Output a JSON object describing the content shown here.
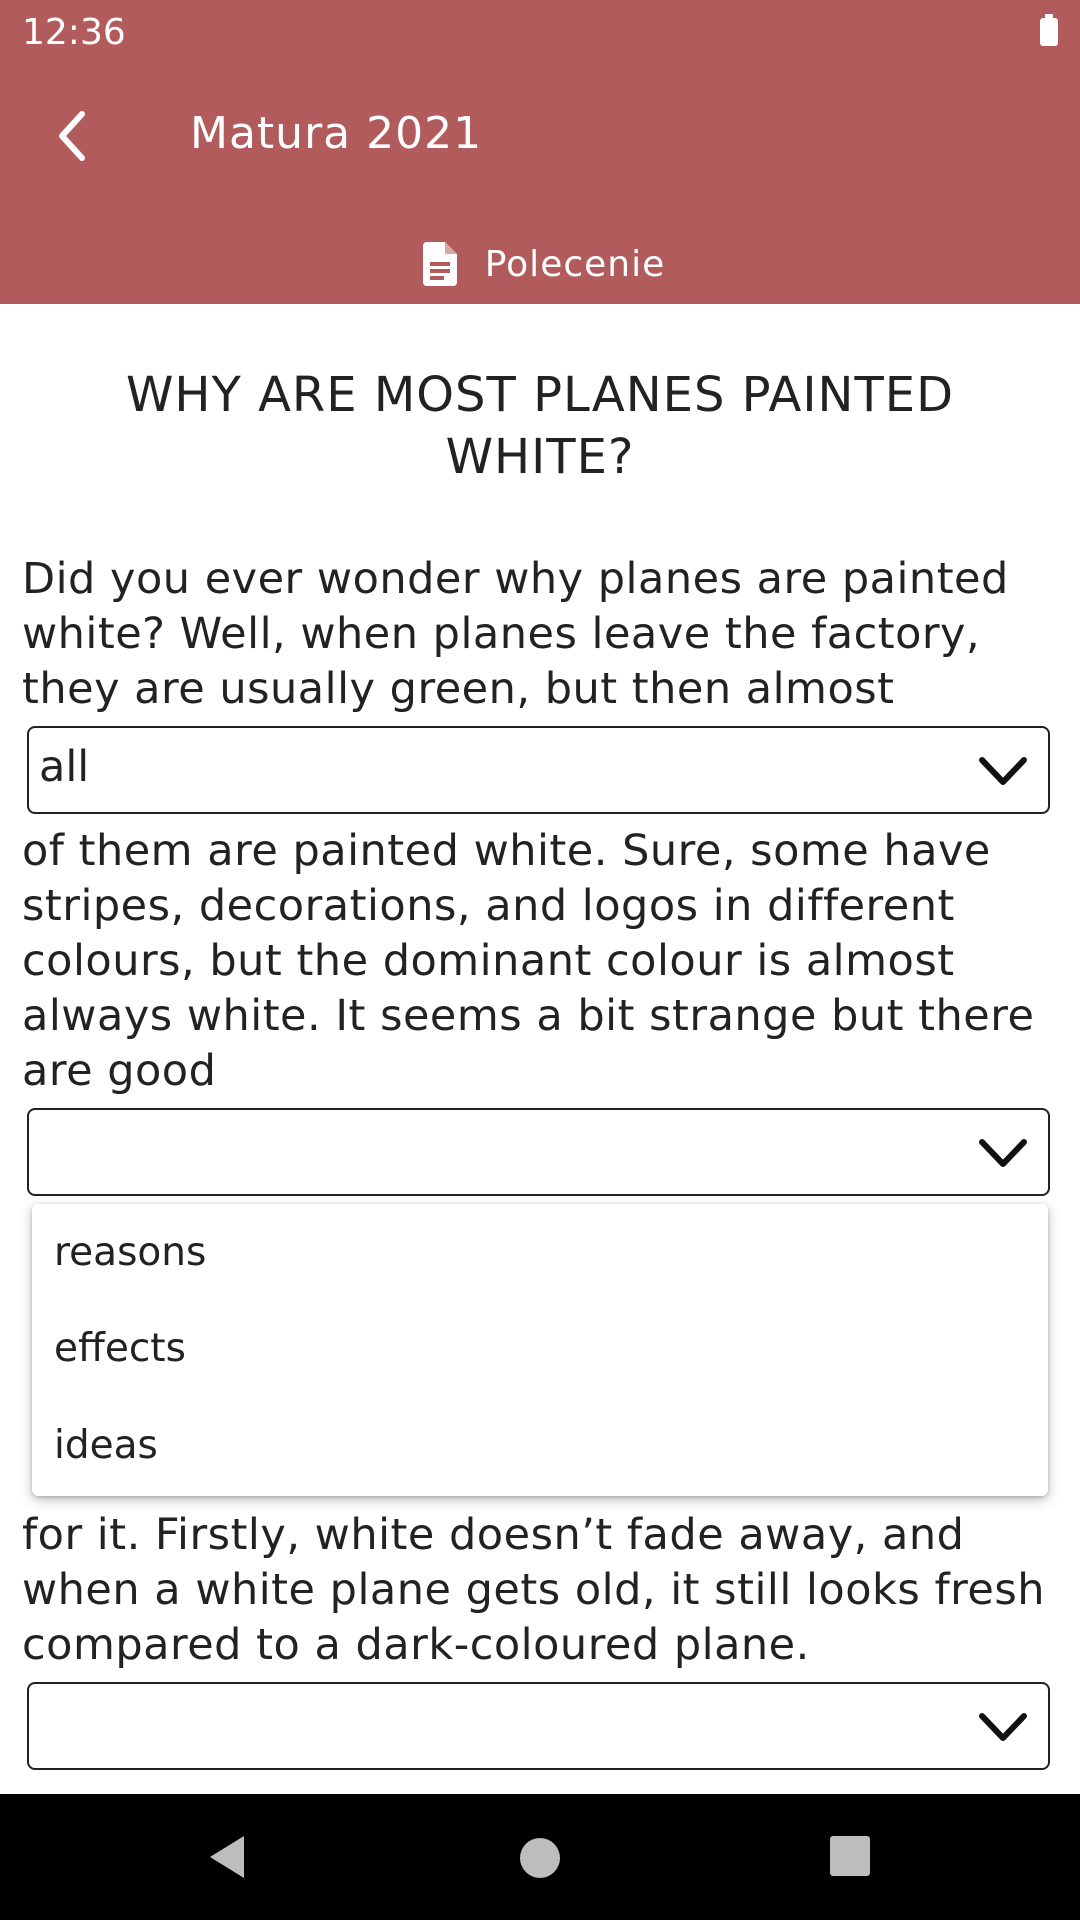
{
  "status_bar": {
    "time": "12:36"
  },
  "app_bar": {
    "title": "Matura 2021",
    "tab_label": "Polecenie",
    "color": "#b25b5c"
  },
  "article": {
    "title": "WHY ARE MOST PLANES PAINTED WHITE?",
    "paragraph_1": "Did you ever wonder why planes are painted white? Well, when planes leave the factory, they are usually green, but then almost",
    "select_1_value": "all",
    "paragraph_2": "of them are painted white. Sure, some have stripes, decorations, and logos in different colours, but the dominant colour is almost always white. It seems a bit strange but there are good",
    "select_2_value": "",
    "dropdown_options": [
      "reasons",
      "effects",
      "ideas"
    ],
    "paragraph_3": "for it. Firstly, white doesn’t fade away, and when a white plane gets old, it still looks fresh compared to a dark-coloured plane.",
    "select_3_value": ""
  }
}
